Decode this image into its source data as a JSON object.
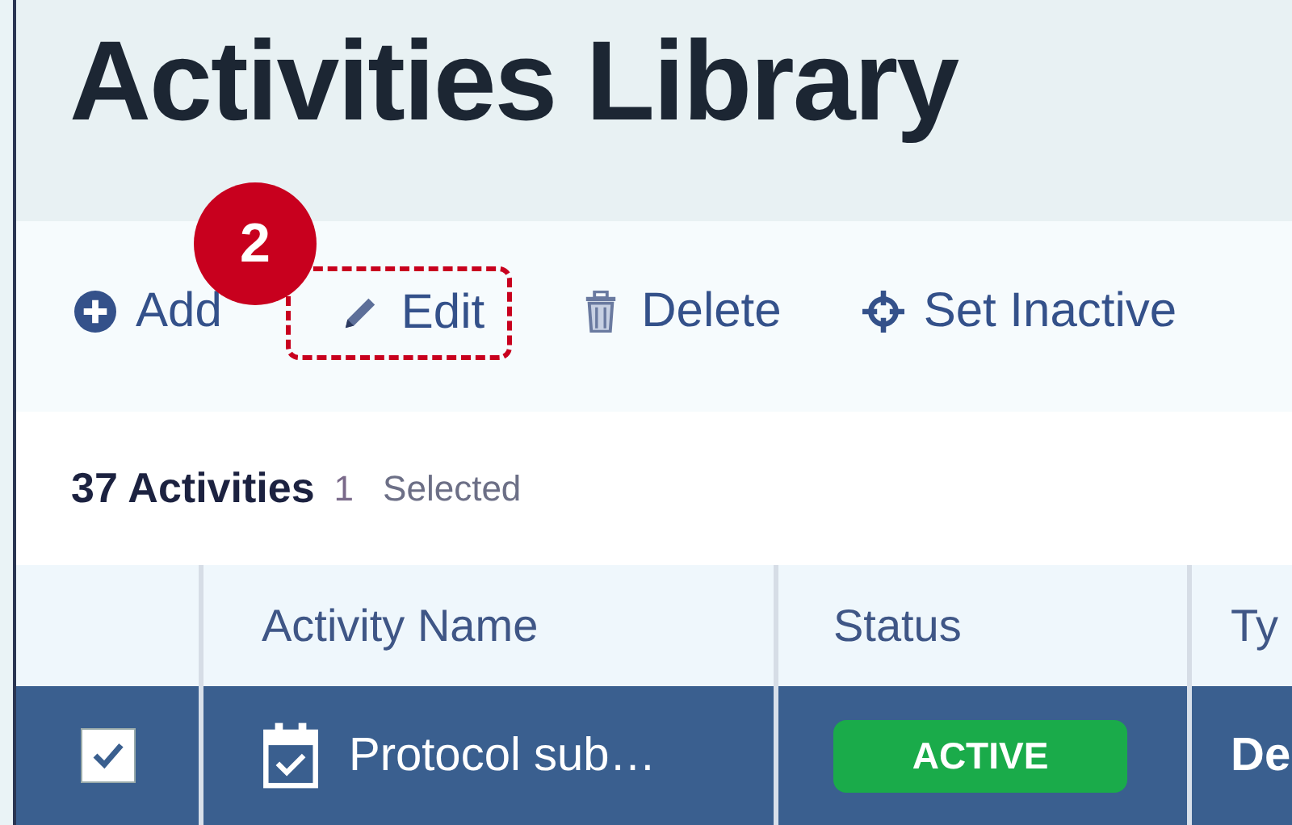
{
  "page": {
    "title": "Activities Library"
  },
  "toolbar": [
    {
      "kind": "add",
      "label": "Add",
      "highlighted": false
    },
    {
      "kind": "edit",
      "label": "Edit",
      "highlighted": true
    },
    {
      "kind": "delete",
      "label": "Delete",
      "highlighted": false
    },
    {
      "kind": "inactive",
      "label": "Set Inactive",
      "highlighted": false
    }
  ],
  "callout": {
    "number": "2"
  },
  "summary": {
    "count": "37 Activities",
    "selected_count": "1",
    "selected_label": "Selected"
  },
  "table": {
    "columns": [
      {
        "label": "Activity Name"
      },
      {
        "label": "Status"
      },
      {
        "label": "Ty"
      }
    ],
    "rows": [
      {
        "selected": true,
        "checked": true,
        "name": "Protocol sub…",
        "status": "ACTIVE",
        "column_4": "De"
      }
    ]
  }
}
